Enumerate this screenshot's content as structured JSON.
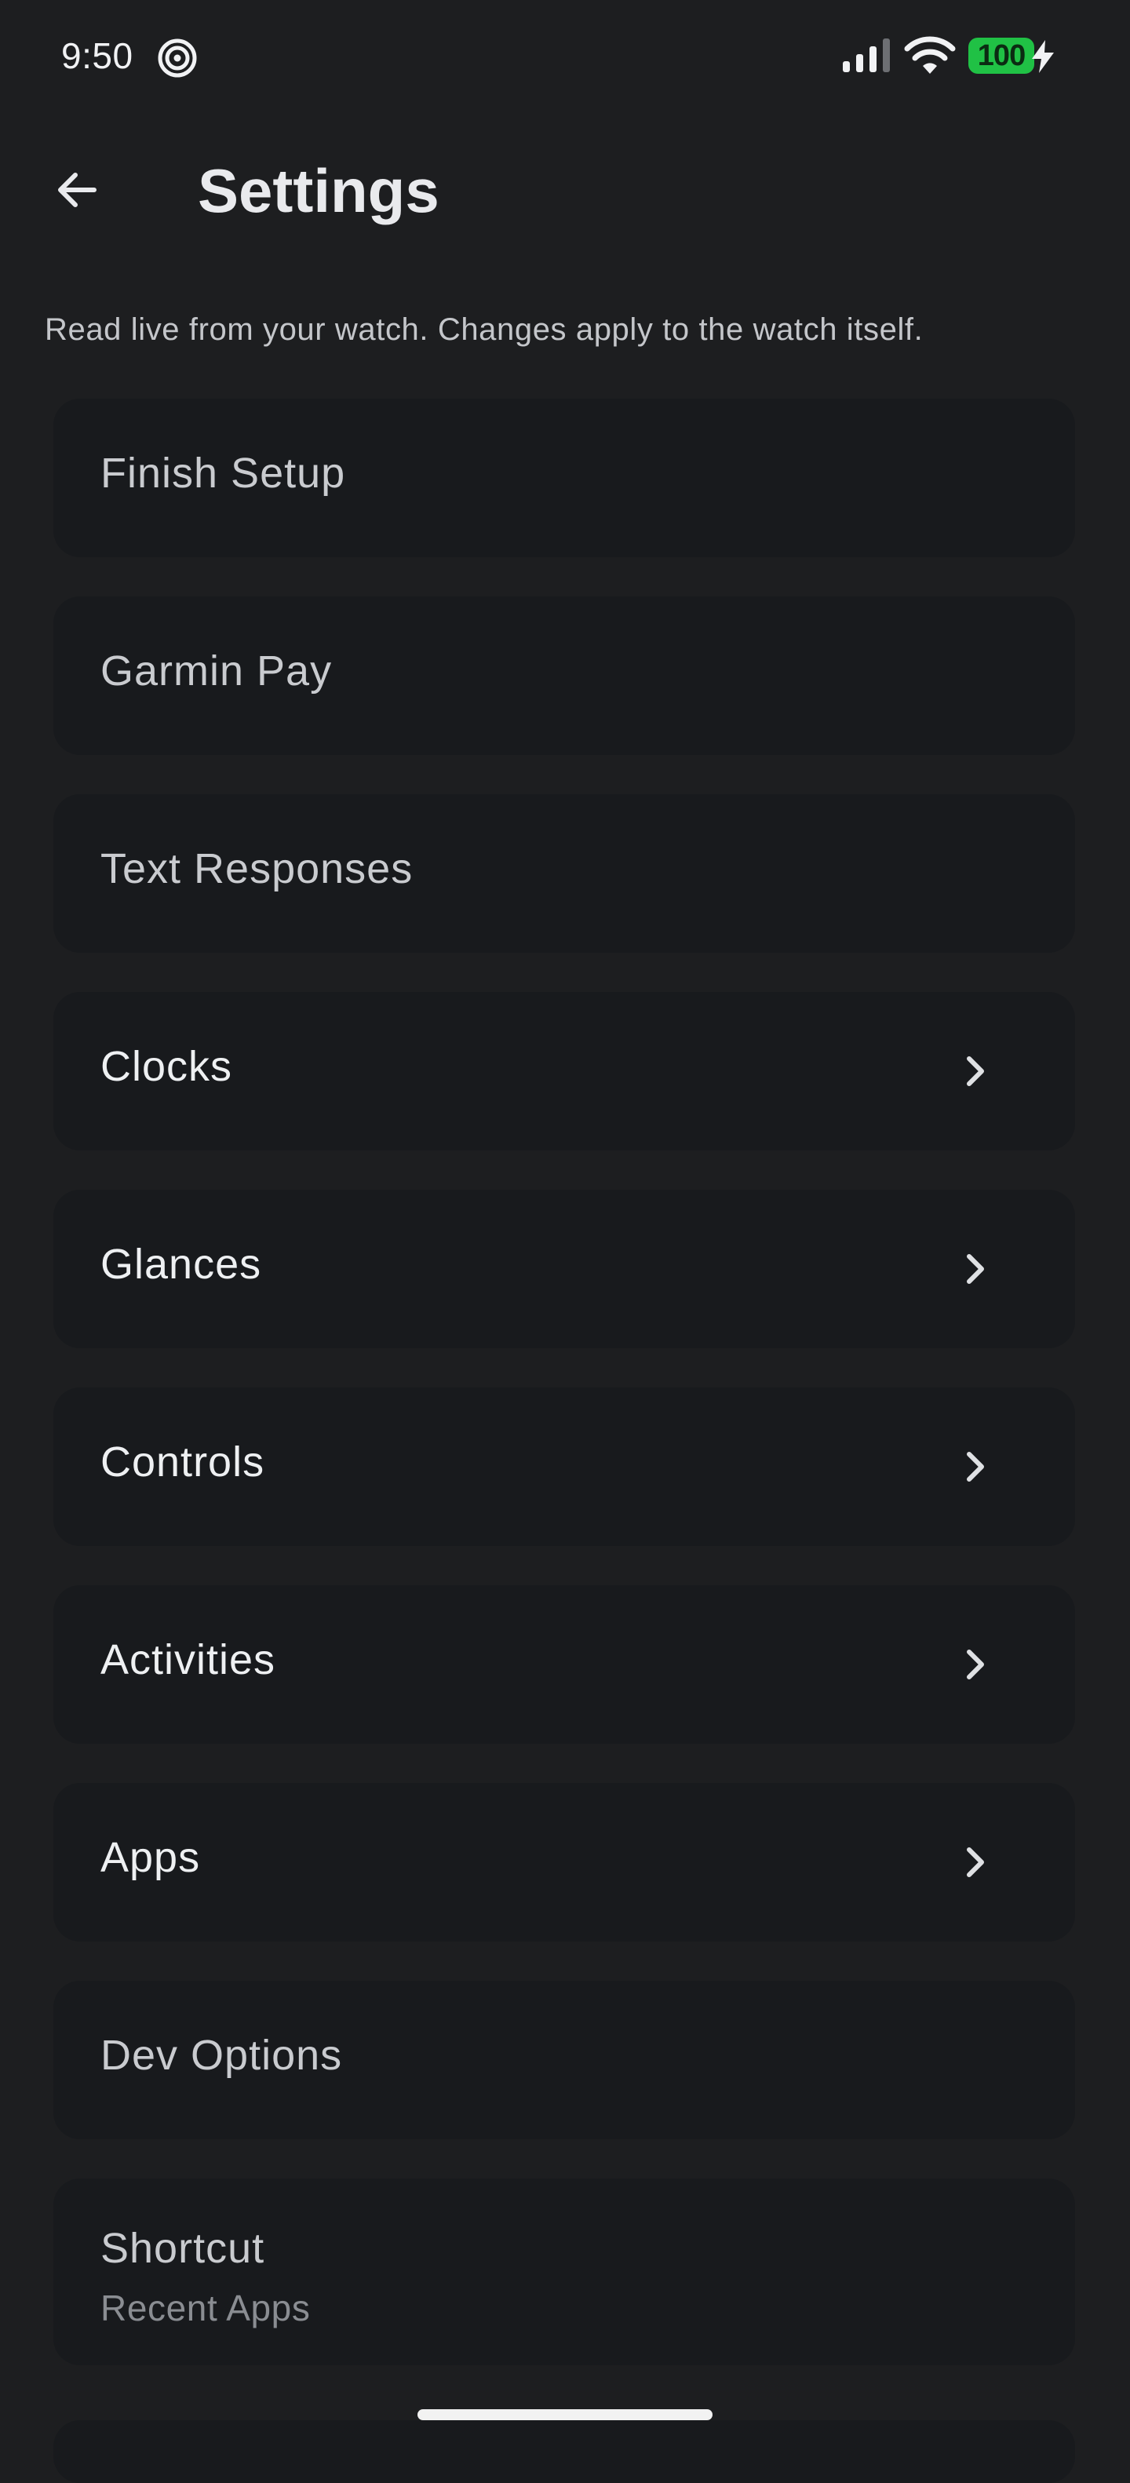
{
  "status_bar": {
    "time": "9:50",
    "app_icon": "spiral-notification-icon",
    "signal_icon": "cellular-signal-icon",
    "wifi_icon": "wifi-icon",
    "battery_level": "100",
    "battery_color": "#20c145",
    "charging_icon": "lightning-bolt-icon"
  },
  "header": {
    "back_icon": "arrow-left-icon",
    "title": "Settings"
  },
  "subtitle": "Read live from your watch. Changes apply to the watch itself.",
  "items": [
    {
      "label": "Finish Setup",
      "style": "dim",
      "chevron": false
    },
    {
      "label": "Garmin Pay",
      "style": "dim",
      "chevron": false
    },
    {
      "label": "Text Responses",
      "style": "dim",
      "chevron": false
    },
    {
      "label": "Clocks",
      "style": "bright",
      "chevron": true
    },
    {
      "label": "Glances",
      "style": "bright",
      "chevron": true
    },
    {
      "label": "Controls",
      "style": "bright",
      "chevron": true
    },
    {
      "label": "Activities",
      "style": "bright",
      "chevron": true
    },
    {
      "label": "Apps",
      "style": "bright",
      "chevron": true
    },
    {
      "label": "Dev Options",
      "style": "dim",
      "chevron": false
    },
    {
      "label": "Shortcut",
      "sublabel": "Recent Apps",
      "style": "dim",
      "chevron": false
    }
  ],
  "colors": {
    "background": "#1d1e20",
    "card": "#181a1d",
    "text_primary": "#eef0f2",
    "text_secondary": "#8a8d92"
  }
}
